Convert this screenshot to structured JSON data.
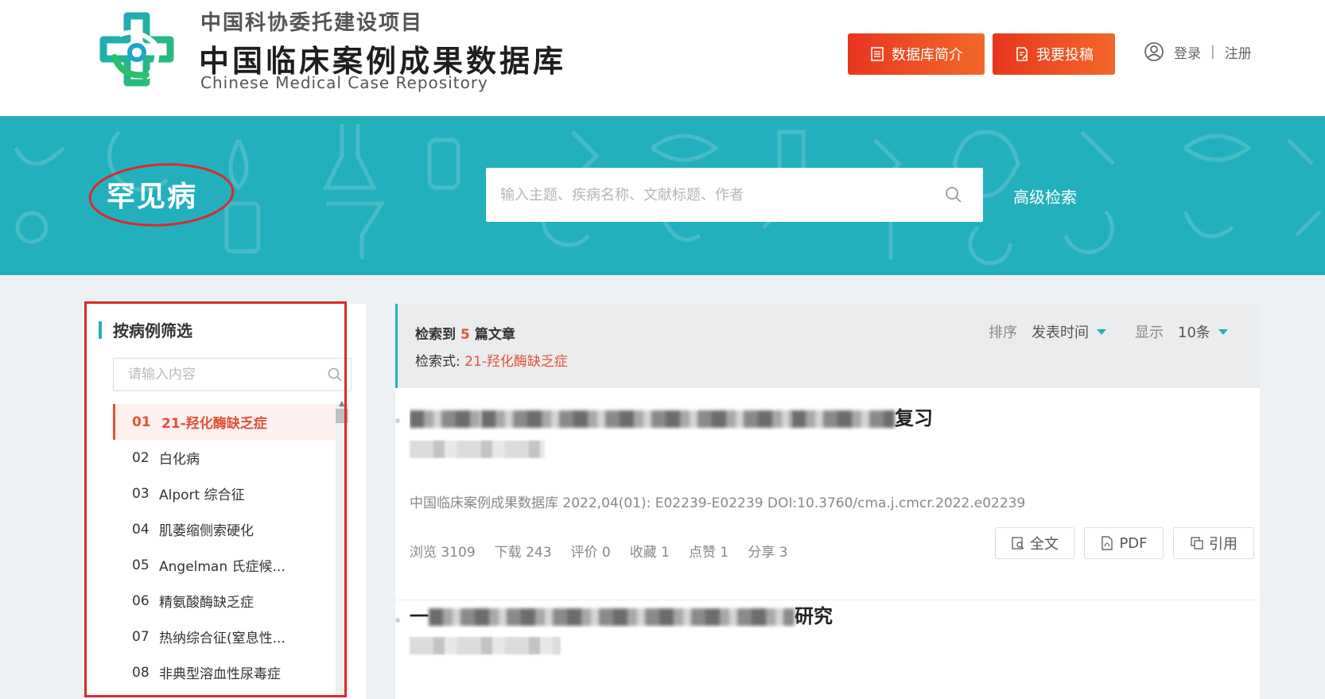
{
  "header": {
    "subtitle": "中国科协委托建设项目",
    "title": "中国临床案例成果数据库",
    "title_en": "Chinese Medical Case Repository",
    "btn_intro": "数据库简介",
    "btn_submit": "我要投稿",
    "login": "登录",
    "separator": "|",
    "register": "注册"
  },
  "banner": {
    "title": "罕见病",
    "search_placeholder": "输入主题、疾病名称、文献标题、作者",
    "advanced_search": "高级检索"
  },
  "sidebar": {
    "heading": "按病例筛选",
    "search_placeholder": "请输入内容",
    "items": [
      {
        "num": "01",
        "name": "21-羟化酶缺乏症"
      },
      {
        "num": "02",
        "name": "白化病"
      },
      {
        "num": "03",
        "name": "Alport 综合征"
      },
      {
        "num": "04",
        "name": "肌萎缩侧索硬化"
      },
      {
        "num": "05",
        "name": "Angelman 氏症候..."
      },
      {
        "num": "06",
        "name": "精氨酸酶缺乏症"
      },
      {
        "num": "07",
        "name": "热纳综合征(窒息性..."
      },
      {
        "num": "08",
        "name": "非典型溶血性尿毒症"
      }
    ]
  },
  "results": {
    "count_prefix": "检索到",
    "count": "5",
    "count_suffix": "篇文章",
    "query_label": "检索式:",
    "query_value": "21-羟化酶缺乏症",
    "sort_label": "排序",
    "sort_value": "发表时间",
    "show_label": "显示",
    "show_value": "10条"
  },
  "articles": [
    {
      "title_left": "伴肾上腺",
      "title_right": "复习",
      "meta": "中国临床案例成果数据库   2022,04(01): E02239-E02239   DOI:10.3760/cma.j.cmcr.2022.e02239",
      "stats": {
        "views": "浏览 3109",
        "downloads": "下载 243",
        "reviews": "评价 0",
        "favorites": "收藏 1",
        "likes": "点赞 1",
        "shares": "分享 3"
      },
      "actions": {
        "full": "全文",
        "pdf": "PDF",
        "cite": "引用"
      }
    },
    {
      "title_left": "一",
      "title_right": "研究"
    }
  ],
  "colors": {
    "accent": "#23b0bd",
    "highlight": "#e0533a",
    "button": "#e8361e"
  }
}
